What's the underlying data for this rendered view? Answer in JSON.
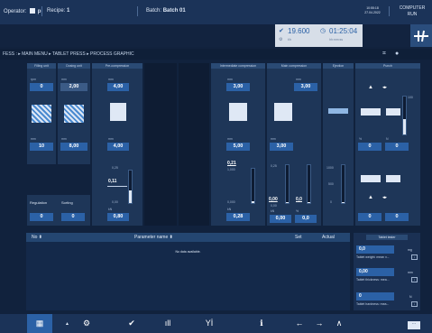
{
  "header": {
    "operator_label": "Operator:",
    "operator_value": "p",
    "recipe_label": "Recipe:",
    "recipe_value": "1",
    "batch_label": "Batch:",
    "batch_value": "Batch 01",
    "time": "10:55:18",
    "date": "27.04.2022",
    "mode_line1": "COMPUTER",
    "mode_line2": "RUN"
  },
  "kpi": {
    "count_value": "19.600",
    "count_unit": "t/h",
    "timer_value": "01:25:04",
    "timer_unit": "hh:mm:ss"
  },
  "breadcrumb": "FESS : ▸ MAIN MENU ▸ TABLET PRESS ▸ PROCESS GRAPHIC",
  "panels": {
    "filling": {
      "title": "Filling unit",
      "unit_top": "rpm",
      "top": "0",
      "unit_bottom": "mm",
      "bottom": "10"
    },
    "dosing": {
      "title": "Dosing unit",
      "unit_top": "mm",
      "top": "2,00",
      "unit_bottom": "mm",
      "bottom": "8,00"
    },
    "precompression": {
      "title": "Pre-compression",
      "unit_top": "mm",
      "top": "4,00",
      "unit_bottom": "mm",
      "bottom": "4,00",
      "gauge_top": "0,11",
      "kn_unit": "kN",
      "kn": "0,80",
      "scale_hi": "0,25",
      "scale_lo": "0,00"
    },
    "intermediate": {
      "title": "Intermediate compression",
      "unit_top": "mm",
      "top": "3,00",
      "unit_bottom": "mm",
      "bottom": "5,00",
      "gauge_top": "0,21",
      "kn_unit": "kN",
      "kn": "0,28",
      "scale_hi": "1,000",
      "scale_lo": "0,000"
    },
    "main": {
      "title": "Main compression",
      "unit_top": "mm",
      "top": "3,00",
      "unit_bottom": "mm",
      "bottom": "3,00",
      "left_val": "0,00",
      "right_val": "0,0",
      "unit_kn": "kN",
      "unit_pct": "%",
      "kn": "0,00",
      "pct": "0,0",
      "scale_hi": "0,25",
      "scale_lo": "0,00"
    },
    "ejection": {
      "title": "Ejection",
      "scale_hi": "1000",
      "scale_mid": "500",
      "scale_lo": "0"
    },
    "punch": {
      "title": "Punch",
      "left_unit": "%",
      "right_unit": "N",
      "left": "0",
      "right": "0",
      "left2": "0",
      "right2": "0",
      "scale_hi": "100"
    }
  },
  "regulation": {
    "label": "Regulation",
    "value": "0"
  },
  "sorting": {
    "label": "Sorting",
    "value": "0"
  },
  "gauges": {
    "precompression_level": 0.4,
    "intermediate_level": 0.05,
    "main_left_level": 0.02,
    "main_right_level": 0.02,
    "ejection_level": 0.02,
    "punch_level": 0.4
  },
  "table": {
    "col_no": "No ⬍",
    "col_param": "Parameter name ⬍",
    "col_set": "Set",
    "col_actual": "Actual",
    "empty_text": "No data available."
  },
  "tablet_tester": {
    "title": "Tablet tester",
    "items": [
      {
        "value": "0,0",
        "unit": "mg",
        "label": "Tablet weight: mean v..."
      },
      {
        "value": "0,00",
        "unit": "mm",
        "label": "Tablet thickness: mea..."
      },
      {
        "value": "0",
        "unit": "N",
        "label": "Tablet hardness: mea..."
      }
    ],
    "info_label": "i"
  },
  "bottom_nav": {
    "items": [
      "▦",
      "⚙",
      "✔",
      "ıll",
      "Yİ",
      "ℹ"
    ],
    "small_up": "▲",
    "arrow_left": "←",
    "arrow_right": "→",
    "arrow_up": "∧",
    "more": "···"
  },
  "colors": {
    "accent": "#2b61a6",
    "background": "#11223d"
  }
}
